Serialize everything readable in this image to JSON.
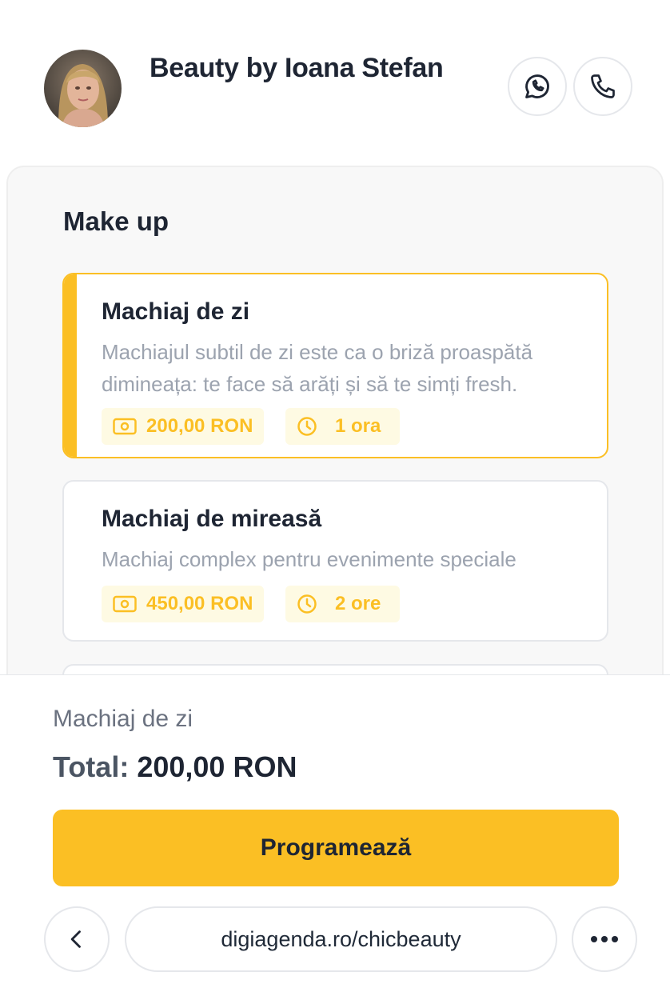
{
  "header": {
    "business_name": "Beauty by Ioana Stefan",
    "avatar_icon": "profile-photo",
    "whatsapp_icon": "whatsapp-icon",
    "phone_icon": "phone-icon"
  },
  "category": {
    "title": "Make up"
  },
  "services": [
    {
      "name": "Machiaj de zi",
      "description": "Machiajul subtil de zi este ca o briză proaspătă dimineața: te face să arăți și să te simți fresh.",
      "price": "200,00 RON",
      "duration": "1 ora",
      "selected": true
    },
    {
      "name": "Machiaj de mireasă",
      "description": "Machiaj complex pentru evenimente speciale",
      "price": "450,00 RON",
      "duration": "2 ore",
      "selected": false
    }
  ],
  "summary": {
    "selected_service": "Machiaj de zi",
    "total_label": "Total:",
    "total_value": "200,00 RON"
  },
  "cta": {
    "label": "Programează"
  },
  "browser": {
    "url": "digiagenda.ro/chicbeauty",
    "back_icon": "chevron-left-icon",
    "more_icon": "more-horizontal-icon"
  },
  "colors": {
    "accent": "#fbbf24",
    "chip_bg": "#fefae3",
    "text_dark": "#1e2533",
    "text_muted": "#9ca3af"
  }
}
